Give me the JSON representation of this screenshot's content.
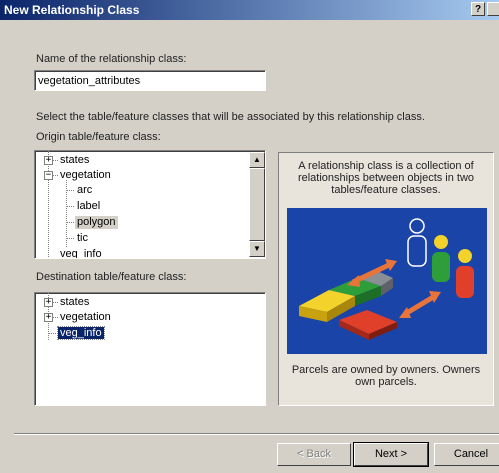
{
  "dialog": {
    "title": "New Relationship Class",
    "help_button": "?"
  },
  "name_field": {
    "label": "Name of the relationship class:",
    "value": "vegetation_attributes"
  },
  "instruction": "Select the table/feature classes that will be associated by this relationship class.",
  "origin": {
    "label": "Origin table/feature class:",
    "items": [
      {
        "label": "states",
        "expander": "+"
      },
      {
        "label": "vegetation",
        "expander": "−"
      },
      {
        "label": "arc"
      },
      {
        "label": "label"
      },
      {
        "label": "polygon"
      },
      {
        "label": "tic"
      },
      {
        "label": "veg_info"
      }
    ]
  },
  "destination": {
    "label": "Destination table/feature class:",
    "items": [
      {
        "label": "states",
        "expander": "+"
      },
      {
        "label": "vegetation",
        "expander": "+"
      },
      {
        "label": "veg_info"
      }
    ]
  },
  "info": {
    "top_text": "A relationship class is a collection of relationships between objects in two tables/feature classes.",
    "bottom_text": "Parcels are owned by owners. Owners own parcels."
  },
  "buttons": {
    "back": "< Back",
    "next": "Next >",
    "cancel": "Cancel"
  },
  "colors": {
    "title_start": "#0a246a",
    "title_end": "#a6caf0",
    "selection": "#0a246a",
    "illustration_bg": "#1a44a8"
  }
}
